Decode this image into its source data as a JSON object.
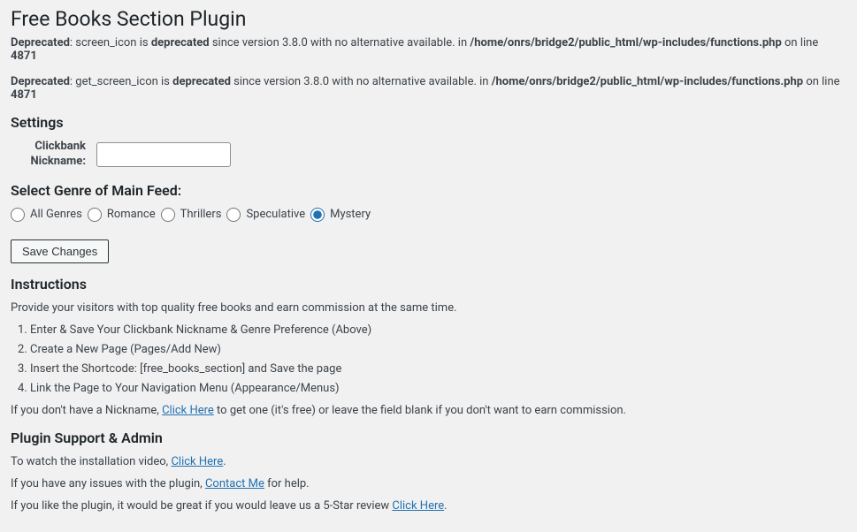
{
  "page_title": "Free Books Section Plugin",
  "deprecations": [
    {
      "prefix": "Deprecated",
      "text1": ": screen_icon is ",
      "bold1": "deprecated",
      "text2": " since version 3.8.0 with no alternative available. in ",
      "path": "/home/onrs/bridge2/public_html/wp-includes/functions.php",
      "text3": " on line ",
      "line": "4871"
    },
    {
      "prefix": "Deprecated",
      "text1": ": get_screen_icon is ",
      "bold1": "deprecated",
      "text2": " since version 3.8.0 with no alternative available. in ",
      "path": "/home/onrs/bridge2/public_html/wp-includes/functions.php",
      "text3": " on line ",
      "line": "4871"
    }
  ],
  "settings": {
    "heading": "Settings",
    "nickname_label": "Clickbank Nickname:",
    "nickname_value": ""
  },
  "genre": {
    "heading": "Select Genre of Main Feed:",
    "options": [
      {
        "label": "All Genres",
        "checked": false
      },
      {
        "label": "Romance",
        "checked": false
      },
      {
        "label": "Thrillers",
        "checked": false
      },
      {
        "label": "Speculative",
        "checked": false
      },
      {
        "label": "Mystery",
        "checked": true
      }
    ]
  },
  "save_button": "Save Changes",
  "instructions": {
    "heading": "Instructions",
    "intro": "Provide your visitors with top quality free books and earn commission at the same time.",
    "steps": [
      "Enter & Save Your Clickbank Nickname & Genre Preference (Above)",
      "Create a New Page (Pages/Add New)",
      "Insert the Shortcode: [free_books_section] and Save the page",
      "Link the Page to Your Navigation Menu (Appearance/Menus)"
    ],
    "nickname_note_pre": "If you don't have a Nickname, ",
    "nickname_link": "Click Here",
    "nickname_note_post": " to get one (it's free) or leave the field blank if you don't want to earn commission."
  },
  "support": {
    "heading": "Plugin Support & Admin",
    "video_pre": "To watch the installation video, ",
    "video_link": "Click Here",
    "video_post": ".",
    "issues_pre": "If you have any issues with the plugin, ",
    "issues_link": "Contact Me",
    "issues_post": " for help.",
    "rating_pre": "If you like the plugin, it would be great if you would leave us a 5-Star review ",
    "rating_link": "Click Here",
    "rating_post": "."
  }
}
